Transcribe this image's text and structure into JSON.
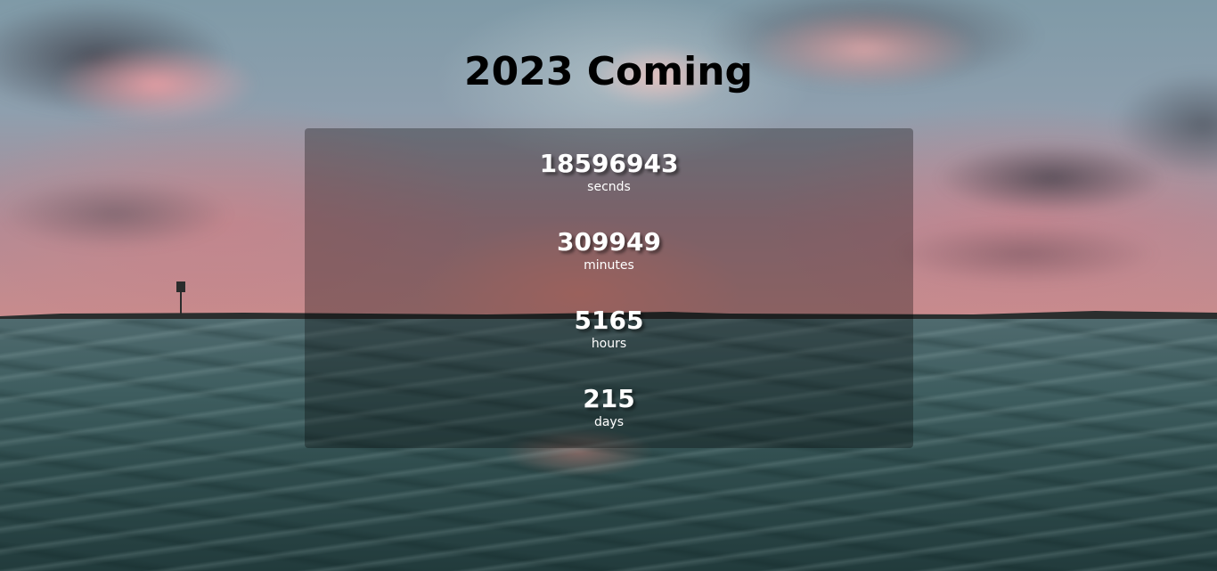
{
  "header": {
    "title": "2023 Coming"
  },
  "countdown": [
    {
      "value": "18596943",
      "label": "secnds"
    },
    {
      "value": "309949",
      "label": "minutes"
    },
    {
      "value": "5165",
      "label": "hours"
    },
    {
      "value": "215",
      "label": "days"
    }
  ],
  "background": {
    "image": "ocean-sunset-background"
  },
  "colors": {
    "title": "#000000",
    "panel_text": "#ffffff"
  }
}
